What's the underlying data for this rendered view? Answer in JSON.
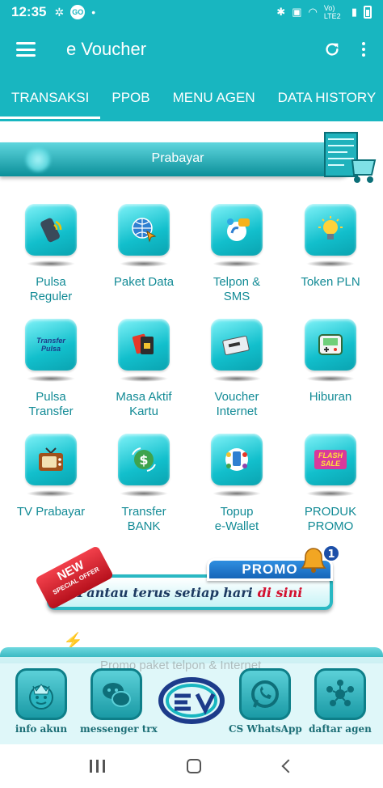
{
  "status_bar": {
    "time": "12:35",
    "network_label": "Vo) LTE2",
    "icons": [
      "fan-icon",
      "go-icon",
      "dot-icon",
      "bluetooth-icon",
      "lock-icon",
      "wifi-icon",
      "signal-icon",
      "battery-icon"
    ]
  },
  "app_bar": {
    "title": "e Voucher",
    "icons": [
      "menu-icon",
      "refresh-icon",
      "more-vert-icon"
    ]
  },
  "tabs": [
    {
      "label": "TRANSAKSI",
      "active": true
    },
    {
      "label": "PPOB",
      "active": false
    },
    {
      "label": "MENU AGEN",
      "active": false
    },
    {
      "label": "DATA HISTORY",
      "active": false
    }
  ],
  "banner": {
    "label": "Prabayar"
  },
  "menu": [
    {
      "label": "Pulsa\nReguler",
      "icon": "phone-wave-icon"
    },
    {
      "label": "Paket Data",
      "icon": "globe-cursor-icon"
    },
    {
      "label": "Telpon &\nSMS",
      "icon": "chat-phone-icon"
    },
    {
      "label": "Token PLN",
      "icon": "lightbulb-icon"
    },
    {
      "label": "Pulsa\nTransfer",
      "icon": "transfer-pulsa-icon",
      "icon_text": "Transfer Pulsa"
    },
    {
      "label": "Masa Aktif\nKartu",
      "icon": "sim-cards-icon"
    },
    {
      "label": "Voucher\nInternet",
      "icon": "voucher-card-icon"
    },
    {
      "label": "Hiburan",
      "icon": "game-console-icon"
    },
    {
      "label": "TV Prabayar",
      "icon": "retro-tv-icon"
    },
    {
      "label": "Transfer\nBANK",
      "icon": "money-transfer-icon"
    },
    {
      "label": "Topup\ne-Wallet",
      "icon": "ewallet-icon"
    },
    {
      "label": "PRODUK\nPROMO",
      "icon": "flash-sale-icon",
      "icon_text": "FLASH SALE"
    }
  ],
  "promo": {
    "tag": "PROMO",
    "ribbon_big": "NEW",
    "ribbon_small": "SPECIAL OFFER",
    "badge_number": "1",
    "text_main": "Pantau terus setiap hari",
    "text_highlight": "di sini"
  },
  "bottom_marquee": "Promo paket telpon & Internet",
  "bottom_nav": [
    {
      "label": "info akun",
      "icon": "robot-crown-icon"
    },
    {
      "label": "messenger trx",
      "icon": "wechat-icon"
    },
    {
      "label": "",
      "icon": "app-logo-icon"
    },
    {
      "label": "CS WhatsApp",
      "icon": "whatsapp-icon"
    },
    {
      "label": "daftar agen",
      "icon": "people-network-icon"
    }
  ],
  "colors": {
    "primary": "#18b6c0",
    "label": "#138b96",
    "promo_blue": "#1665b8",
    "promo_red": "#d3102f"
  }
}
